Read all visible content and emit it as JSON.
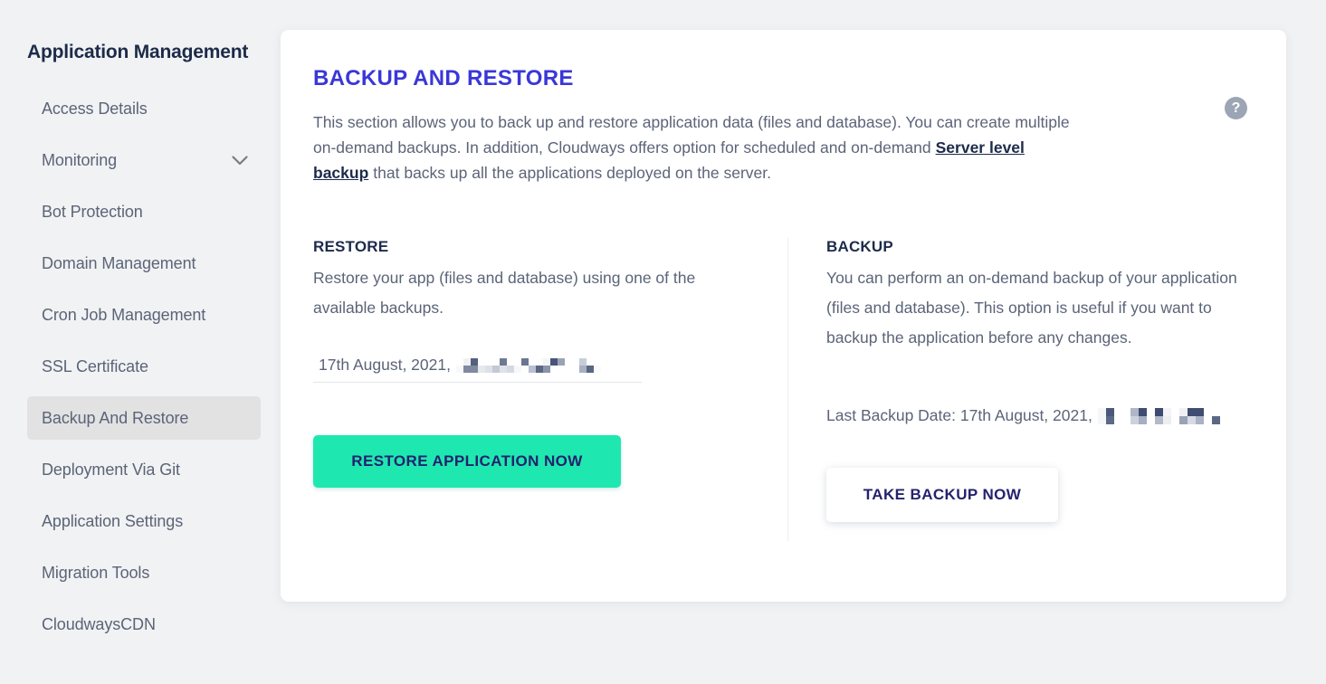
{
  "sidebar": {
    "title": "Application Management",
    "items": [
      {
        "label": "Access Details",
        "icon": null,
        "active": false
      },
      {
        "label": "Monitoring",
        "icon": "chevron-down-icon",
        "active": false
      },
      {
        "label": "Bot Protection",
        "icon": null,
        "active": false
      },
      {
        "label": "Domain Management",
        "icon": null,
        "active": false
      },
      {
        "label": "Cron Job Management",
        "icon": null,
        "active": false
      },
      {
        "label": "SSL Certificate",
        "icon": null,
        "active": false
      },
      {
        "label": "Backup And Restore",
        "icon": null,
        "active": true
      },
      {
        "label": "Deployment Via Git",
        "icon": null,
        "active": false
      },
      {
        "label": "Application Settings",
        "icon": null,
        "active": false
      },
      {
        "label": "Migration Tools",
        "icon": null,
        "active": false
      },
      {
        "label": "CloudwaysCDN",
        "icon": null,
        "active": false
      }
    ]
  },
  "card": {
    "title": "BACKUP AND RESTORE",
    "help_icon": "help-circle-icon",
    "intro_part1": "This section allows you to back up and restore application data (files and database). You can create multiple on-demand backups. In addition, Cloudways offers option for scheduled and on-demand",
    "intro_link": "Server level backup",
    "intro_part2": "that backs up all the applications deployed on the server.",
    "restore": {
      "heading": "RESTORE",
      "description": "Restore your app (files and database) using one of the available backups.",
      "selected_backup": "17th August, 2021,",
      "selected_backup_redacted": true,
      "button_label": "RESTORE APPLICATION NOW"
    },
    "backup": {
      "heading": "BACKUP",
      "description": "You can perform an on-demand backup of your application (files and database). This option is useful if you want to backup the application before any changes.",
      "last_backup_label": "Last Backup Date: 17th August, 2021,",
      "last_backup_redacted": true,
      "button_label": "TAKE BACKUP NOW"
    }
  },
  "colors": {
    "page_background": "#f1f2f3",
    "card_background": "#ffffff",
    "title_accent": "#3a37d9",
    "body_text": "#5b6478",
    "heading_text": "#1d2b4a",
    "restore_button": "#1ee8b0",
    "button_text": "#24226e",
    "sidebar_active": "#e2e2e3",
    "help_icon": "#9ca5b4"
  },
  "redaction_blocks": {
    "restore_select": {
      "block": 8,
      "rows": [
        [
          "#ffffff",
          "#eff1f4",
          "#53607f",
          "#ffffff",
          "#ffffff",
          "#ffffff",
          "#6e7a94",
          "#ffffff",
          "#ffffff",
          "#6a7791",
          "#ffffff",
          "#fdfdfe",
          "#f3f5f7",
          "#48557a",
          "#9aa3b6",
          "#ffffff",
          "#ffffff",
          "#c7cdd9",
          "#ffffff",
          "#ffffff",
          "#ffffff",
          "#ffffff"
        ],
        [
          "#f7f8fa",
          "#7f8aa0",
          "#808ba1",
          "#e7e9ee",
          "#dde0e7",
          "#c3c9d6",
          "#dfe2e8",
          "#d4d9e2",
          "#f7f8fa",
          "#ffffff",
          "#b9c0cf",
          "#5b6884",
          "#8b95aa",
          "#ffffff",
          "#ffffff",
          "#ffffff",
          "#ffffff",
          "#a8b0c2",
          "#5a6782",
          "#fbfbfc",
          "#ffffff",
          "#ffffff"
        ]
      ]
    },
    "last_backup": {
      "block": 9,
      "rows": [
        [
          "#f6f7f9",
          "#4b587b",
          "#ffffff",
          "#ffffff",
          "#afb7c7",
          "#3f4d72",
          "#ffffff",
          "#3d4b70",
          "#f3f4f7",
          "#ffffff",
          "#eef0f3",
          "#3f4d72",
          "#3f4d72",
          "#ffffff",
          "#ffffff",
          "#ffffff"
        ],
        [
          "#f6f7f9",
          "#5d6a87",
          "#ffffff",
          "#ffffff",
          "#ccd1db",
          "#a6aec1",
          "#ffffff",
          "#b2bac9",
          "#eceef2",
          "#ffffff",
          "#9aa3b6",
          "#d6dae2",
          "#aab2c4",
          "#ffffff",
          "#5b6884",
          "#ffffff"
        ]
      ]
    }
  }
}
